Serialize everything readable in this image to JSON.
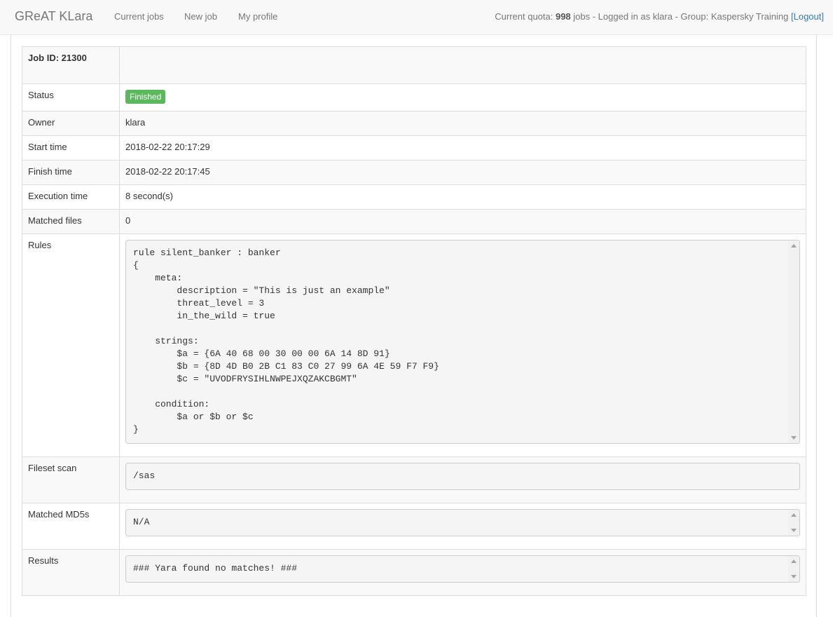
{
  "navbar": {
    "brand": "GReAT KLara",
    "links": [
      "Current jobs",
      "New job",
      "My profile"
    ],
    "quota_prefix": "Current quota: ",
    "quota_value": "998",
    "quota_suffix": " jobs - Logged in as klara - Group: Kaspersky Training ",
    "logout": "[Logout]"
  },
  "job": {
    "header": "Job ID: 21300",
    "rows": {
      "status_label": "Status",
      "status_value": "Finished",
      "owner_label": "Owner",
      "owner_value": "klara",
      "start_label": "Start time",
      "start_value": "2018-02-22 20:17:29",
      "finish_label": "Finish time",
      "finish_value": "2018-02-22 20:17:45",
      "exec_label": "Execution time",
      "exec_value": "8 second(s)",
      "matched_files_label": "Matched files",
      "matched_files_value": "0",
      "rules_label": "Rules",
      "rules_value": "rule silent_banker : banker\n{\n    meta:\n        description = \"This is just an example\"\n        threat_level = 3\n        in_the_wild = true\n\n    strings:\n        $a = {6A 40 68 00 30 00 00 6A 14 8D 91}\n        $b = {8D 4D B0 2B C1 83 C0 27 99 6A 4E 59 F7 F9}\n        $c = \"UVODFRYSIHLNWPEJXQZAKCBGMT\"\n\n    condition:\n        $a or $b or $c\n}",
      "fileset_label": "Fileset scan",
      "fileset_value": "/sas",
      "md5_label": "Matched MD5s",
      "md5_value": "N/A",
      "results_label": "Results",
      "results_value": "### Yara found no matches! ###"
    }
  },
  "colors": {
    "status_success": "#5cb85c",
    "link": "#337ab7"
  }
}
